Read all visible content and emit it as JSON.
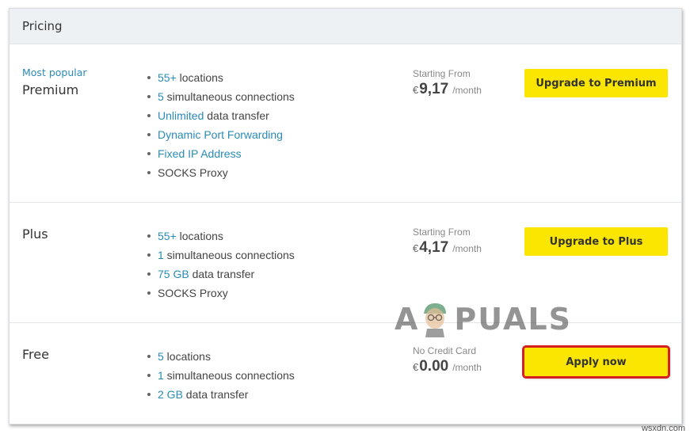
{
  "header": {
    "title": "Pricing"
  },
  "tiers": [
    {
      "tag": "Most popular",
      "name": "Premium",
      "features": [
        {
          "hl": "55+",
          "text": " locations"
        },
        {
          "hl": "5",
          "text": " simultaneous connections"
        },
        {
          "hl": "Unlimited",
          "text": " data transfer"
        },
        {
          "hl": "Dynamic Port Forwarding",
          "text": ""
        },
        {
          "hl": "Fixed IP Address",
          "text": ""
        },
        {
          "hl": "",
          "text": "SOCKS Proxy"
        }
      ],
      "price_caption": "Starting From",
      "currency": "€",
      "amount": "9,17",
      "per": "/month",
      "button": "Upgrade to Premium"
    },
    {
      "tag": "",
      "name": "Plus",
      "features": [
        {
          "hl": "55+",
          "text": " locations"
        },
        {
          "hl": "1",
          "text": " simultaneous connections"
        },
        {
          "hl": "75 GB",
          "text": " data transfer"
        },
        {
          "hl": "",
          "text": "SOCKS Proxy"
        }
      ],
      "price_caption": "Starting From",
      "currency": "€",
      "amount": "4,17",
      "per": "/month",
      "button": "Upgrade to Plus"
    },
    {
      "tag": "",
      "name": "Free",
      "features": [
        {
          "hl": "5",
          "text": " locations"
        },
        {
          "hl": "1",
          "text": " simultaneous connections"
        },
        {
          "hl": "2 GB",
          "text": " data transfer"
        }
      ],
      "price_caption": "No Credit Card",
      "currency": "€",
      "amount": "0.00",
      "per": "/month",
      "button": "Apply now"
    }
  ],
  "watermark": {
    "left": "A",
    "right": "PUALS"
  },
  "site_tag": "wsxdn.com",
  "colors": {
    "accent": "#2a8bb5",
    "button": "#fae600",
    "highlight_border": "#d61f1f"
  }
}
